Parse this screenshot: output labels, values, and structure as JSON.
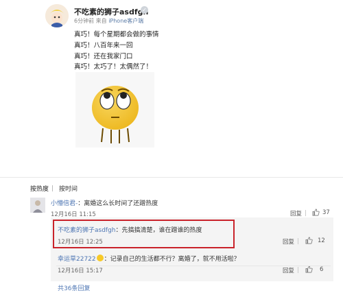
{
  "post": {
    "username": "不吃素的狮子asdfgh",
    "time": "6分钟前",
    "source_prefix": "来自",
    "source": "iPhone客户端",
    "lines": [
      "真巧！每个星期都会做的事情",
      "真巧！八百年来一回",
      "真巧！还在我家门口",
      "真巧！太巧了！太偶然了！"
    ]
  },
  "comments_section": {
    "tabs": [
      "按热度",
      "按时间"
    ],
    "comments": [
      {
        "name": "小懵倍君-",
        "text": "：离婚这么长时间了还蹭热度",
        "time": "12月16日 11:15",
        "reply_label": "回复",
        "likes": "37"
      },
      {
        "name": "不吃素的狮子asdfgh",
        "text": "：先搞搞清楚，谁在蹭谁的热度",
        "time": "12月16日 12:25",
        "reply_label": "回复",
        "likes": "12"
      },
      {
        "name": "幸运草22722",
        "text": "：记录自己的生活都不行？离婚了，就不用活啦？",
        "time": "12月16日 15:17",
        "reply_label": "回复",
        "likes": "6"
      }
    ],
    "total_replies": "共36条回复"
  },
  "colors": {
    "highlight": "#c9222a",
    "link": "#4e76b3"
  }
}
